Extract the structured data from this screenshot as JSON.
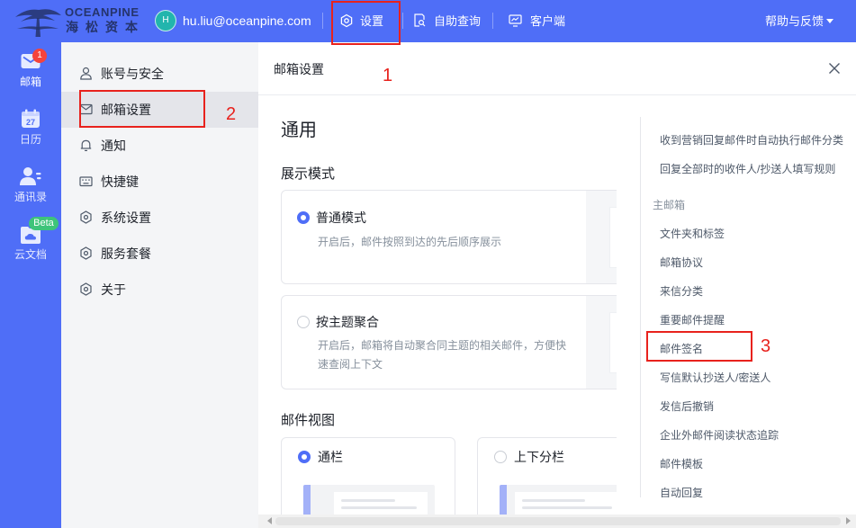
{
  "theme": {
    "primary": "#4f6ef7",
    "annotation": "#e8221d",
    "avatar": "#22b5ad",
    "unread_badge": "#f5433b",
    "beta_badge": "#3ec47a"
  },
  "header": {
    "logo": {
      "brand_en": "OCEANPINE",
      "brand_cn": "海松资本",
      "icon": "pine-tree-logo"
    },
    "user": {
      "avatar_letter": "H",
      "email": "hu.liu@oceanpine.com"
    },
    "nav": [
      {
        "label": "设置",
        "icon": "hex-gear-icon"
      },
      {
        "label": "自助查询",
        "icon": "doc-search-icon"
      },
      {
        "label": "客户端",
        "icon": "monitor-icon"
      }
    ],
    "help": {
      "label": "帮助与反馈",
      "icon": "caret-down-icon"
    }
  },
  "rail": [
    {
      "label": "邮箱",
      "icon": "mail-icon",
      "badge": "1",
      "active": true
    },
    {
      "label": "日历",
      "icon": "calendar-icon",
      "day": "27",
      "active": false
    },
    {
      "label": "通讯录",
      "icon": "contacts-icon",
      "active": false
    },
    {
      "label": "云文档",
      "icon": "cloud-docs-icon",
      "badge": "Beta",
      "active": false
    }
  ],
  "settings_nav": {
    "items": [
      {
        "label": "账号与安全",
        "icon": "user-icon",
        "selected": false
      },
      {
        "label": "邮箱设置",
        "icon": "mail-outline-icon",
        "selected": true
      },
      {
        "label": "通知",
        "icon": "bell-icon",
        "selected": false
      },
      {
        "label": "快捷键",
        "icon": "keyboard-icon",
        "selected": false
      },
      {
        "label": "系统设置",
        "icon": "hex-gear-icon",
        "selected": false
      },
      {
        "label": "服务套餐",
        "icon": "hex-gear-icon",
        "selected": false
      },
      {
        "label": "关于",
        "icon": "hex-gear-icon",
        "selected": false
      }
    ]
  },
  "panel": {
    "title": "邮箱设置",
    "section_title": "通用",
    "display_mode": {
      "title": "展示模式",
      "options": [
        {
          "label": "普通模式",
          "desc": "开启后，邮件按照到达的先后顺序展示",
          "selected": true
        },
        {
          "label": "按主题聚合",
          "desc": "开启后，邮箱将自动聚合同主题的相关邮件，方便快速查阅上下文",
          "selected": false
        }
      ]
    },
    "mail_view": {
      "title": "邮件视图",
      "options": [
        {
          "label": "通栏",
          "selected": true
        },
        {
          "label": "上下分栏",
          "selected": false
        }
      ]
    }
  },
  "toc": {
    "items_top": [
      "收到营销回复邮件时自动执行邮件分类",
      "回复全部时的收件人/抄送人填写规则"
    ],
    "section": "主邮箱",
    "items": [
      "文件夹和标签",
      "邮箱协议",
      "来信分类",
      "重要邮件提醒",
      "邮件签名",
      "写信默认抄送人/密送人",
      "发信后撤销",
      "企业外邮件阅读状态追踪",
      "邮件模板",
      "自动回复"
    ]
  },
  "annotations": [
    "1",
    "2",
    "3"
  ]
}
